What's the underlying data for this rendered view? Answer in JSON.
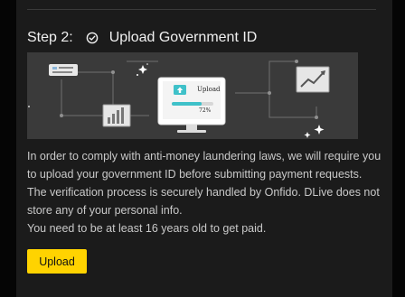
{
  "step": {
    "number_label": "Step 2:",
    "title": "Upload Government ID",
    "icon": "check-circle-icon"
  },
  "illustration": {
    "monitor_upload_label": "Upload",
    "progress_label": "72%",
    "progress_value": 0.72
  },
  "description": "In order to comply with anti-money laundering laws, we will require you to upload your government ID before submitting payment requests. The verification process is securely handled by Onfido. DLive does not store any of your personal info.",
  "age_notice": "You need to be at least 16 years old to get paid.",
  "upload_button": {
    "label": "Upload"
  },
  "colors": {
    "accent": "#ffd300",
    "panel_bg": "#1b1b1b",
    "illustration_bg": "#3a3a3a",
    "progress_fill": "#3fc1c9"
  }
}
